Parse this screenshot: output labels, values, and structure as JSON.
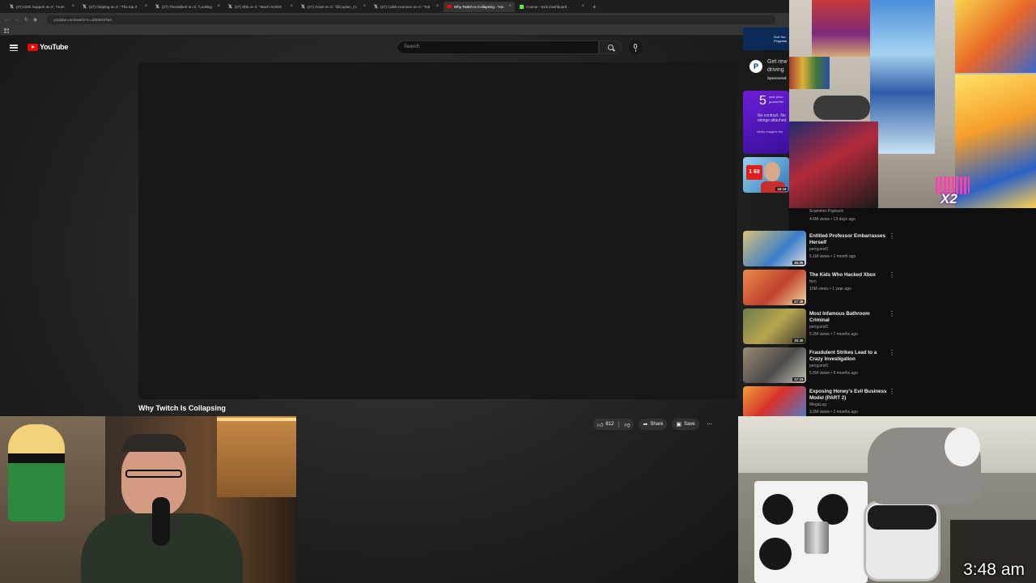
{
  "browser": {
    "tabs": [
      {
        "label": "(27) KDE Support on X: \"Hum",
        "icon": "x-logo",
        "active": false
      },
      {
        "label": "(27) Clipping on X: \"The top 3",
        "icon": "x-logo",
        "active": false
      },
      {
        "label": "(27) TheranBert on X: \"Looking",
        "icon": "x-logo",
        "active": false
      },
      {
        "label": "(27) Shb on X: \"Much GOOD",
        "icon": "x-logo",
        "active": false
      },
      {
        "label": "(27) Grant on X: \"@Coplon_Ci",
        "icon": "x-logo",
        "active": false
      },
      {
        "label": "(27) Caleb Hammer on X: \"Tod",
        "icon": "x-logo",
        "active": false
      },
      {
        "label": "Why Twitch Is Collapsing - You",
        "icon": "youtube",
        "active": true
      },
      {
        "label": "Course - Kick Dashboard",
        "icon": "kick",
        "active": false
      }
    ],
    "url": "youtube.com/watch?v=oZE5iN3T8A"
  },
  "youtube": {
    "logo_text": "YouTube",
    "search_placeholder": "Search",
    "video_title": "Why Twitch Is Collapsing",
    "likes": "812",
    "share_label": "Share",
    "save_label": "Save",
    "ad_top": {
      "lines": [
        "Surf Sm",
        "Progress"
      ]
    },
    "ad_paypal": {
      "line1": "Get rew",
      "line2": "driving",
      "sponsored": "Sponsored"
    },
    "promo": {
      "big": "5",
      "line1": "year price",
      "line2": "guarantee",
      "text": "No contract. No strings attached.",
      "tiny": "xfinity Imagine the"
    },
    "recommendations": [
      {
        "title": "Entitled Professor Embarrasses Herself",
        "channel": "penguinz0",
        "meta": "5.1M views • 1 month ago",
        "duration": "15:05"
      },
      {
        "title": "The Kids Who Hacked Xbox",
        "channel": "fern",
        "meta": "10M views • 1 year ago",
        "duration": "27:38"
      },
      {
        "title": "Most Infamous Bathroom Criminal",
        "channel": "penguinz0",
        "meta": "5.2M views • 7 months ago",
        "duration": "15:40"
      },
      {
        "title": "Fraudulent Strikes Lead to a Crazy Investigation",
        "channel": "penguinz0",
        "meta": "5.5M views • 9 months ago",
        "duration": "17:19"
      },
      {
        "title": "Exposing Honey's Evil Business Model (PART 2)",
        "channel": "MegaLag",
        "meta": "3.2M views • 2 months ago",
        "duration": ""
      }
    ],
    "partial_rec": {
      "channel": "Scammer Payback",
      "meta": "4.6M views • 13 days ago",
      "duration": "18:18"
    }
  },
  "stream": {
    "badge_text": "X2",
    "clock": "3:48 am"
  }
}
